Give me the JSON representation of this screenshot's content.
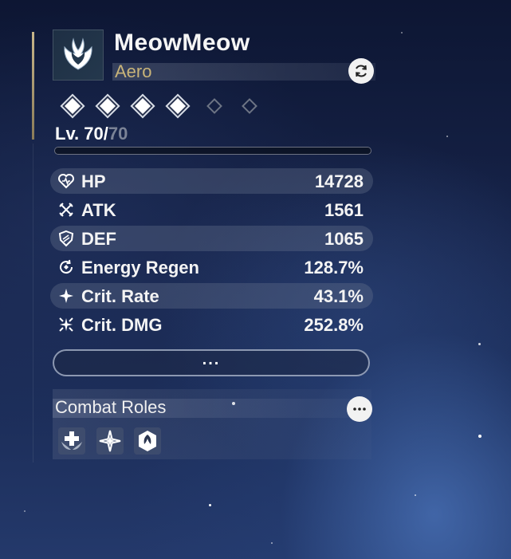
{
  "character": {
    "name": "MeowMeow",
    "element": "Aero",
    "emblem_icon": "aero-emblem-icon",
    "refresh_icon": "refresh-icon"
  },
  "sequence": {
    "unlocked": 4,
    "total": 6
  },
  "level": {
    "current": "Lv. 70/",
    "max": "70"
  },
  "stats": [
    {
      "icon": "heart-icon",
      "label": "HP",
      "value": "14728"
    },
    {
      "icon": "crossed-swords-icon",
      "label": "ATK",
      "value": "1561"
    },
    {
      "icon": "shield-icon",
      "label": "DEF",
      "value": "1065"
    },
    {
      "icon": "energy-regen-icon",
      "label": "Energy Regen",
      "value": "128.7%"
    },
    {
      "icon": "sparkle-icon",
      "label": "Crit. Rate",
      "value": "43.1%"
    },
    {
      "icon": "burst-icon",
      "label": "Crit. DMG",
      "value": "252.8%"
    }
  ],
  "more_button": {
    "label": "..."
  },
  "combat_roles": {
    "title": "Combat Roles",
    "info_icon": "ellipsis-icon",
    "roles": [
      "healing-wing-icon",
      "four-point-star-icon",
      "hex-shield-icon"
    ]
  },
  "colors": {
    "element_gold": "#c9b479",
    "accent_rail": "#c8b68a"
  }
}
